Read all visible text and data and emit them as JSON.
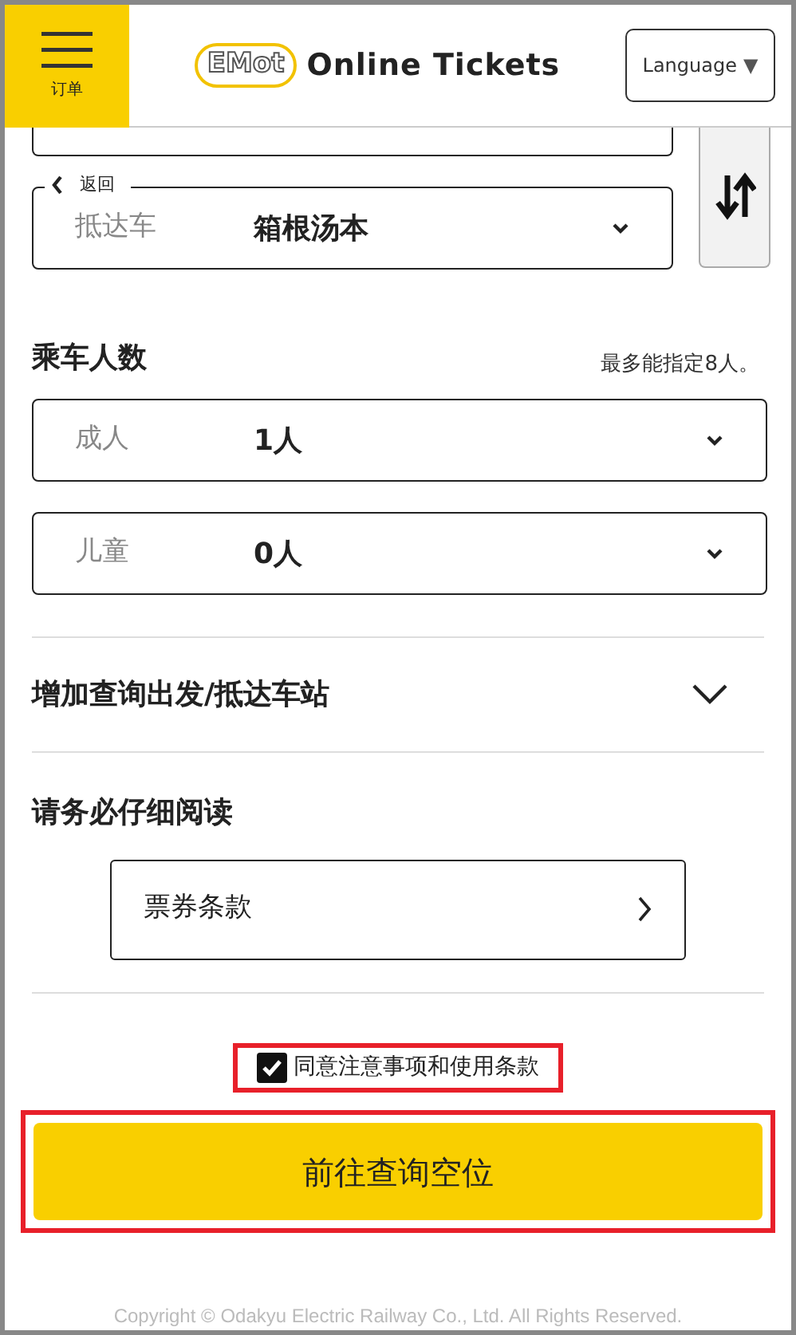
{
  "header": {
    "menu_label": "订单",
    "logo_text": "EMot",
    "title": "Online Tickets",
    "language": "Language",
    "language_caret": "▼"
  },
  "back": {
    "label": "返回"
  },
  "arrival": {
    "label": "抵达车",
    "value": "箱根汤本"
  },
  "passengers": {
    "heading": "乘车人数",
    "note": "最多能指定8人。",
    "fields": [
      {
        "label": "成人",
        "value": "1人"
      },
      {
        "label": "儿童",
        "value": "0人"
      }
    ]
  },
  "add_stations": {
    "label": "增加查询出发/抵达车站",
    "expanded": false
  },
  "notice": {
    "heading": "请务必仔细阅读",
    "link": "票券条款"
  },
  "agree": {
    "label": "同意注意事项和使用条款",
    "checked": true
  },
  "submit": {
    "label": "前往查询空位"
  },
  "copyright": "Copyright © Odakyu Electric Railway Co., Ltd. All Rights Reserved."
}
